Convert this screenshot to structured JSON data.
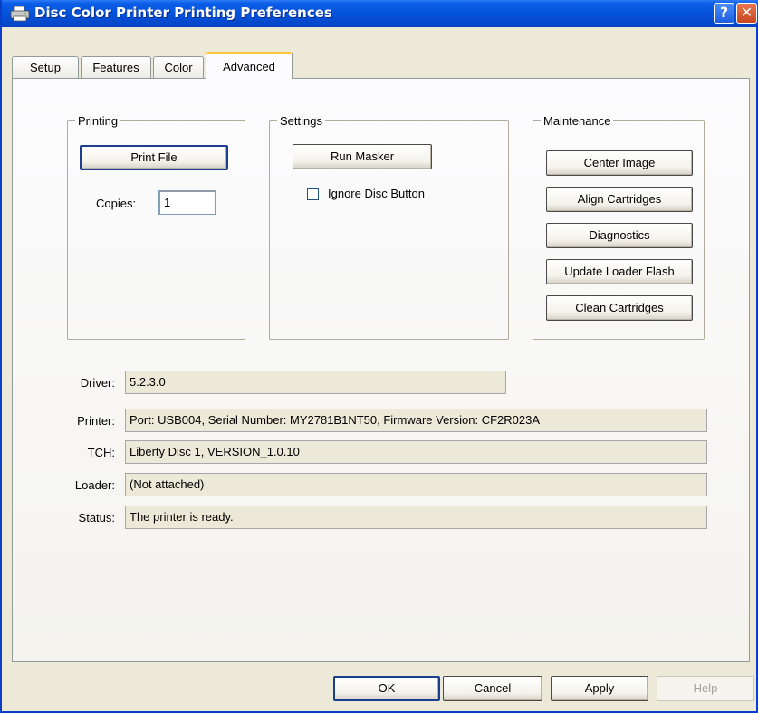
{
  "window": {
    "title": "Disc Color Printer Printing Preferences",
    "help_glyph": "?",
    "close_glyph": "✕"
  },
  "tabs": [
    {
      "label": "Setup"
    },
    {
      "label": "Features"
    },
    {
      "label": "Color"
    },
    {
      "label": "Advanced",
      "active": true
    }
  ],
  "printing": {
    "group_label": "Printing",
    "print_file_label": "Print File",
    "copies_label": "Copies:",
    "copies_value": "1"
  },
  "settings": {
    "group_label": "Settings",
    "run_masker_label": "Run Masker",
    "ignore_disc_label": "Ignore Disc Button",
    "ignore_disc_checked": false
  },
  "maintenance": {
    "group_label": "Maintenance",
    "buttons": [
      "Center Image",
      "Align Cartridges",
      "Diagnostics",
      "Update Loader Flash",
      "Clean Cartridges"
    ]
  },
  "info": {
    "driver_label": "Driver:",
    "driver_value": "5.2.3.0",
    "printer_label": "Printer:",
    "printer_value": "Port: USB004, Serial Number: MY2781B1NT50, Firmware Version: CF2R023A",
    "tch_label": "TCH:",
    "tch_value": "Liberty Disc 1, VERSION_1.0.10",
    "loader_label": "Loader:",
    "loader_value": "(Not attached)",
    "status_label": "Status:",
    "status_value": "The printer is ready."
  },
  "footer": {
    "ok_label": "OK",
    "cancel_label": "Cancel",
    "apply_label": "Apply",
    "help_label": "Help"
  },
  "colors": {
    "titlebar": "#0550d6",
    "dialog_bg": "#ece9d8",
    "active_tab_accent": "#ffc83c"
  }
}
